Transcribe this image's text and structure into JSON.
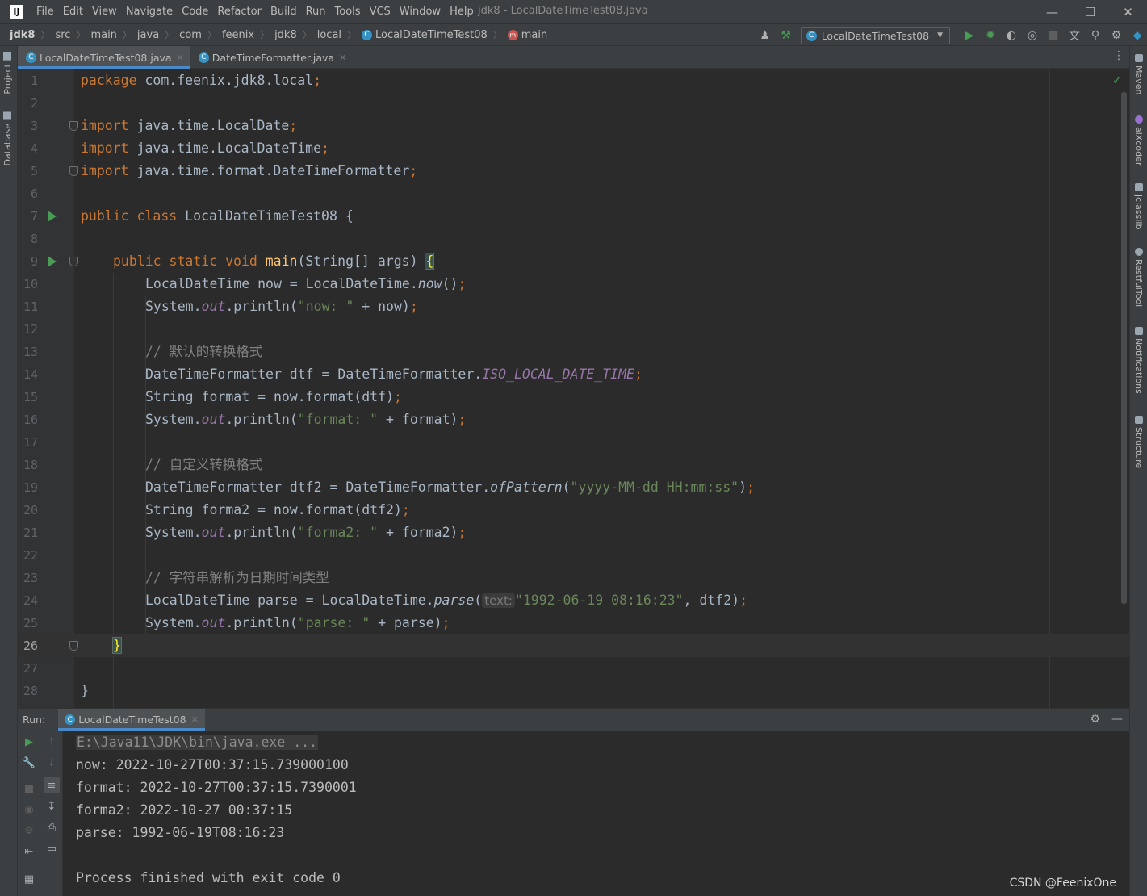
{
  "window": {
    "logo_text": "IJ",
    "title": "jdk8 - LocalDateTimeTest08.java",
    "menu": [
      "File",
      "Edit",
      "View",
      "Navigate",
      "Code",
      "Refactor",
      "Build",
      "Run",
      "Tools",
      "VCS",
      "Window",
      "Help"
    ]
  },
  "breadcrumbs": [
    "jdk8",
    "src",
    "main",
    "java",
    "com",
    "feenix",
    "jdk8",
    "local",
    "LocalDateTimeTest08",
    "main"
  ],
  "run_config": "LocalDateTimeTest08",
  "tabs": [
    {
      "label": "LocalDateTimeTest08.java",
      "active": true
    },
    {
      "label": "DateTimeFormatter.java",
      "active": false
    }
  ],
  "left_tools": [
    "Project",
    "Database"
  ],
  "right_tools": [
    "Maven",
    "aiXcoder",
    "jclasslib",
    "RestfulTool",
    "Notifications",
    "Structure"
  ],
  "editor": {
    "current_line": 26,
    "line_numbers": [
      "1",
      "2",
      "3",
      "4",
      "5",
      "6",
      "7",
      "8",
      "9",
      "10",
      "11",
      "12",
      "13",
      "14",
      "15",
      "16",
      "17",
      "18",
      "19",
      "20",
      "21",
      "22",
      "23",
      "24",
      "25",
      "26",
      "27",
      "28"
    ],
    "inlay_hint": "text:"
  },
  "code_tokens": {
    "l1": [
      "package",
      " com.feenix.jdk8.local",
      ";"
    ],
    "l3": [
      "import",
      " java.time.LocalDate",
      ";"
    ],
    "l4": [
      "import",
      " java.time.LocalDateTime",
      ";"
    ],
    "l5": [
      "import",
      " java.time.format.DateTimeFormatter",
      ";"
    ],
    "l7": [
      "public class",
      " LocalDateTimeTest08 {"
    ],
    "l9": [
      "public static void ",
      "main",
      "(String[] args) ",
      "{"
    ],
    "l10": [
      "LocalDateTime now = LocalDateTime.",
      "now",
      "()",
      ";"
    ],
    "l11": [
      "System.",
      "out",
      ".println(",
      "\"now: \"",
      " + now)",
      ";"
    ],
    "l13": [
      "// 默认的转换格式"
    ],
    "l14": [
      "DateTimeFormatter dtf = DateTimeFormatter.",
      "ISO_LOCAL_DATE_TIME",
      ";"
    ],
    "l15": [
      "String format = now.format(dtf)",
      ";"
    ],
    "l16": [
      "System.",
      "out",
      ".println(",
      "\"format: \"",
      " + format)",
      ";"
    ],
    "l18": [
      "// 自定义转换格式"
    ],
    "l19": [
      "DateTimeFormatter dtf2 = DateTimeFormatter.",
      "ofPattern",
      "(",
      "\"yyyy-MM-dd HH:mm:ss\"",
      ")",
      ";"
    ],
    "l20": [
      "String forma2 = now.format(dtf2)",
      ";"
    ],
    "l21": [
      "System.",
      "out",
      ".println(",
      "\"forma2: \"",
      " + forma2)",
      ";"
    ],
    "l23": [
      "// 字符串解析为日期时间类型"
    ],
    "l24": [
      "LocalDateTime parse = LocalDateTime.",
      "parse",
      "(",
      "\"1992-06-19 08:16:23\"",
      ", dtf2)",
      ";"
    ],
    "l25": [
      "System.",
      "out",
      ".println(",
      "\"parse: \"",
      " + parse)",
      ";"
    ],
    "l26": [
      "}"
    ],
    "l28": [
      "}"
    ]
  },
  "run_panel": {
    "label": "Run:",
    "tab": "LocalDateTimeTest08",
    "output": [
      "E:\\Java11\\JDK\\bin\\java.exe ...",
      "now: 2022-10-27T00:37:15.739000100",
      "format: 2022-10-27T00:37:15.7390001",
      "forma2: 2022-10-27 00:37:15",
      "parse: 1992-06-19T08:16:23",
      "",
      "Process finished with exit code 0"
    ]
  },
  "watermark": "CSDN @FeenixOne",
  "colors": {
    "keyword": "#cc7832",
    "string": "#6a8759",
    "comment": "#808080",
    "method": "#ffc66d",
    "static_field": "#9876aa",
    "accent": "#4a88c7",
    "run_green": "#499c54"
  }
}
